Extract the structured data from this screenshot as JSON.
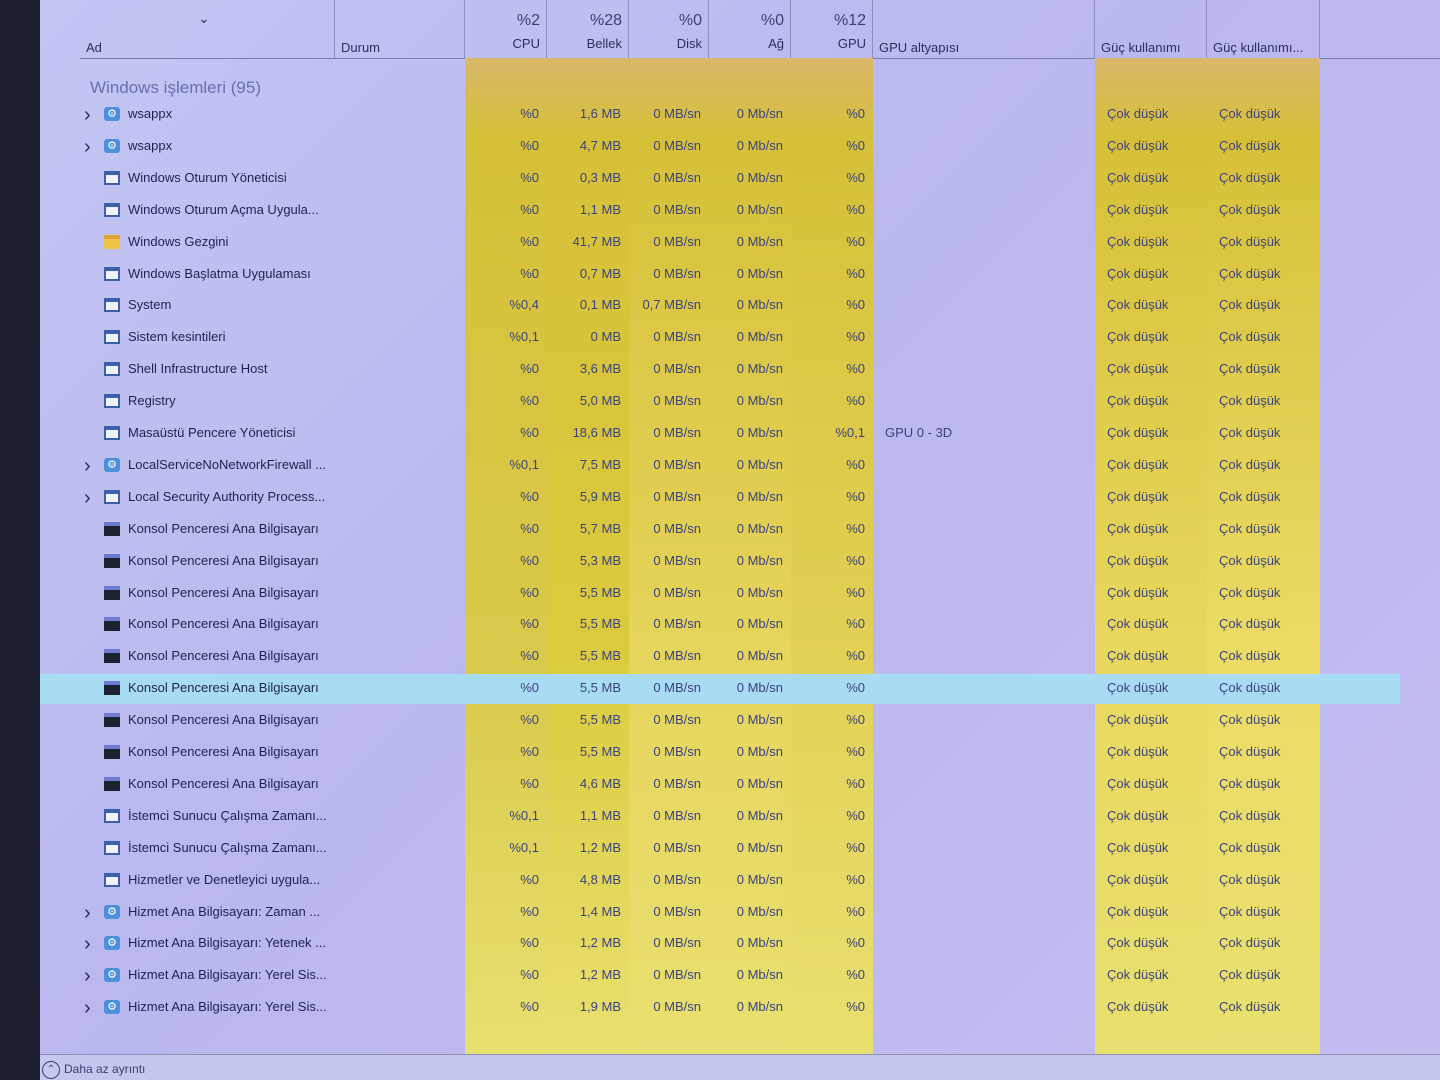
{
  "header": {
    "sort_chevron": "⌄",
    "columns": [
      {
        "key": "name",
        "label": "Ad",
        "percent": ""
      },
      {
        "key": "status",
        "label": "Durum",
        "percent": ""
      },
      {
        "key": "cpu",
        "label": "CPU",
        "percent": "%2"
      },
      {
        "key": "memory",
        "label": "Bellek",
        "percent": "%28"
      },
      {
        "key": "disk",
        "label": "Disk",
        "percent": "%0"
      },
      {
        "key": "network",
        "label": "Ağ",
        "percent": "%0"
      },
      {
        "key": "gpu",
        "label": "GPU",
        "percent": "%12"
      },
      {
        "key": "gpu_engine",
        "label": "GPU altyapısı",
        "percent": ""
      },
      {
        "key": "power",
        "label": "Güç kullanımı",
        "percent": ""
      },
      {
        "key": "power_trend",
        "label": "Güç kullanımı...",
        "percent": ""
      }
    ]
  },
  "group": {
    "title": "Windows işlemleri (95)"
  },
  "processes": [
    {
      "name": "wsappx",
      "icon": "gear",
      "expand": true,
      "cpu": "%0",
      "mem": "1,6 MB",
      "disk": "0 MB/sn",
      "net": "0 Mb/sn",
      "gpu": "%0",
      "engine": "",
      "power": "Çok düşük",
      "trend": "Çok düşük"
    },
    {
      "name": "wsappx",
      "icon": "gear",
      "expand": true,
      "cpu": "%0",
      "mem": "4,7 MB",
      "disk": "0 MB/sn",
      "net": "0 Mb/sn",
      "gpu": "%0",
      "engine": "",
      "power": "Çok düşük",
      "trend": "Çok düşük"
    },
    {
      "name": "Windows Oturum Yöneticisi",
      "icon": "window",
      "expand": false,
      "cpu": "%0",
      "mem": "0,3 MB",
      "disk": "0 MB/sn",
      "net": "0 Mb/sn",
      "gpu": "%0",
      "engine": "",
      "power": "Çok düşük",
      "trend": "Çok düşük"
    },
    {
      "name": "Windows Oturum Açma Uygula...",
      "icon": "window",
      "expand": false,
      "cpu": "%0",
      "mem": "1,1 MB",
      "disk": "0 MB/sn",
      "net": "0 Mb/sn",
      "gpu": "%0",
      "engine": "",
      "power": "Çok düşük",
      "trend": "Çok düşük"
    },
    {
      "name": "Windows Gezgini",
      "icon": "folder",
      "expand": false,
      "cpu": "%0",
      "mem": "41,7 MB",
      "disk": "0 MB/sn",
      "net": "0 Mb/sn",
      "gpu": "%0",
      "engine": "",
      "power": "Çok düşük",
      "trend": "Çok düşük"
    },
    {
      "name": "Windows Başlatma Uygulaması",
      "icon": "window",
      "expand": false,
      "cpu": "%0",
      "mem": "0,7 MB",
      "disk": "0 MB/sn",
      "net": "0 Mb/sn",
      "gpu": "%0",
      "engine": "",
      "power": "Çok düşük",
      "trend": "Çok düşük"
    },
    {
      "name": "System",
      "icon": "window",
      "expand": false,
      "cpu": "%0,4",
      "mem": "0,1 MB",
      "disk": "0,7 MB/sn",
      "net": "0 Mb/sn",
      "gpu": "%0",
      "engine": "",
      "power": "Çok düşük",
      "trend": "Çok düşük"
    },
    {
      "name": "Sistem kesintileri",
      "icon": "window",
      "expand": false,
      "cpu": "%0,1",
      "mem": "0 MB",
      "disk": "0 MB/sn",
      "net": "0 Mb/sn",
      "gpu": "%0",
      "engine": "",
      "power": "Çok düşük",
      "trend": "Çok düşük"
    },
    {
      "name": "Shell Infrastructure Host",
      "icon": "window",
      "expand": false,
      "cpu": "%0",
      "mem": "3,6 MB",
      "disk": "0 MB/sn",
      "net": "0 Mb/sn",
      "gpu": "%0",
      "engine": "",
      "power": "Çok düşük",
      "trend": "Çok düşük"
    },
    {
      "name": "Registry",
      "icon": "window",
      "expand": false,
      "cpu": "%0",
      "mem": "5,0 MB",
      "disk": "0 MB/sn",
      "net": "0 Mb/sn",
      "gpu": "%0",
      "engine": "",
      "power": "Çok düşük",
      "trend": "Çok düşük"
    },
    {
      "name": "Masaüstü Pencere Yöneticisi",
      "icon": "window",
      "expand": false,
      "cpu": "%0",
      "mem": "18,6 MB",
      "disk": "0 MB/sn",
      "net": "0 Mb/sn",
      "gpu": "%0,1",
      "engine": "GPU 0 - 3D",
      "power": "Çok düşük",
      "trend": "Çok düşük"
    },
    {
      "name": "LocalServiceNoNetworkFirewall ...",
      "icon": "gear",
      "expand": true,
      "cpu": "%0,1",
      "mem": "7,5 MB",
      "disk": "0 MB/sn",
      "net": "0 Mb/sn",
      "gpu": "%0",
      "engine": "",
      "power": "Çok düşük",
      "trend": "Çok düşük"
    },
    {
      "name": "Local Security Authority Process...",
      "icon": "window",
      "expand": true,
      "cpu": "%0",
      "mem": "5,9 MB",
      "disk": "0 MB/sn",
      "net": "0 Mb/sn",
      "gpu": "%0",
      "engine": "",
      "power": "Çok düşük",
      "trend": "Çok düşük"
    },
    {
      "name": "Konsol Penceresi Ana Bilgisayarı",
      "icon": "console",
      "expand": false,
      "cpu": "%0",
      "mem": "5,7 MB",
      "disk": "0 MB/sn",
      "net": "0 Mb/sn",
      "gpu": "%0",
      "engine": "",
      "power": "Çok düşük",
      "trend": "Çok düşük"
    },
    {
      "name": "Konsol Penceresi Ana Bilgisayarı",
      "icon": "console",
      "expand": false,
      "cpu": "%0",
      "mem": "5,3 MB",
      "disk": "0 MB/sn",
      "net": "0 Mb/sn",
      "gpu": "%0",
      "engine": "",
      "power": "Çok düşük",
      "trend": "Çok düşük"
    },
    {
      "name": "Konsol Penceresi Ana Bilgisayarı",
      "icon": "console",
      "expand": false,
      "cpu": "%0",
      "mem": "5,5 MB",
      "disk": "0 MB/sn",
      "net": "0 Mb/sn",
      "gpu": "%0",
      "engine": "",
      "power": "Çok düşük",
      "trend": "Çok düşük"
    },
    {
      "name": "Konsol Penceresi Ana Bilgisayarı",
      "icon": "console",
      "expand": false,
      "cpu": "%0",
      "mem": "5,5 MB",
      "disk": "0 MB/sn",
      "net": "0 Mb/sn",
      "gpu": "%0",
      "engine": "",
      "power": "Çok düşük",
      "trend": "Çok düşük"
    },
    {
      "name": "Konsol Penceresi Ana Bilgisayarı",
      "icon": "console",
      "expand": false,
      "cpu": "%0",
      "mem": "5,5 MB",
      "disk": "0 MB/sn",
      "net": "0 Mb/sn",
      "gpu": "%0",
      "engine": "",
      "power": "Çok düşük",
      "trend": "Çok düşük"
    },
    {
      "name": "Konsol Penceresi Ana Bilgisayarı",
      "icon": "console",
      "expand": false,
      "selected": true,
      "cpu": "%0",
      "mem": "5,5 MB",
      "disk": "0 MB/sn",
      "net": "0 Mb/sn",
      "gpu": "%0",
      "engine": "",
      "power": "Çok düşük",
      "trend": "Çok düşük"
    },
    {
      "name": "Konsol Penceresi Ana Bilgisayarı",
      "icon": "console",
      "expand": false,
      "cpu": "%0",
      "mem": "5,5 MB",
      "disk": "0 MB/sn",
      "net": "0 Mb/sn",
      "gpu": "%0",
      "engine": "",
      "power": "Çok düşük",
      "trend": "Çok düşük"
    },
    {
      "name": "Konsol Penceresi Ana Bilgisayarı",
      "icon": "console",
      "expand": false,
      "cpu": "%0",
      "mem": "5,5 MB",
      "disk": "0 MB/sn",
      "net": "0 Mb/sn",
      "gpu": "%0",
      "engine": "",
      "power": "Çok düşük",
      "trend": "Çok düşük"
    },
    {
      "name": "Konsol Penceresi Ana Bilgisayarı",
      "icon": "console",
      "expand": false,
      "cpu": "%0",
      "mem": "4,6 MB",
      "disk": "0 MB/sn",
      "net": "0 Mb/sn",
      "gpu": "%0",
      "engine": "",
      "power": "Çok düşük",
      "trend": "Çok düşük"
    },
    {
      "name": "İstemci Sunucu Çalışma Zamanı...",
      "icon": "window",
      "expand": false,
      "cpu": "%0,1",
      "mem": "1,1 MB",
      "disk": "0 MB/sn",
      "net": "0 Mb/sn",
      "gpu": "%0",
      "engine": "",
      "power": "Çok düşük",
      "trend": "Çok düşük"
    },
    {
      "name": "İstemci Sunucu Çalışma Zamanı...",
      "icon": "window",
      "expand": false,
      "cpu": "%0,1",
      "mem": "1,2 MB",
      "disk": "0 MB/sn",
      "net": "0 Mb/sn",
      "gpu": "%0",
      "engine": "",
      "power": "Çok düşük",
      "trend": "Çok düşük"
    },
    {
      "name": "Hizmetler ve Denetleyici uygula...",
      "icon": "window",
      "expand": false,
      "cpu": "%0",
      "mem": "4,8 MB",
      "disk": "0 MB/sn",
      "net": "0 Mb/sn",
      "gpu": "%0",
      "engine": "",
      "power": "Çok düşük",
      "trend": "Çok düşük"
    },
    {
      "name": "Hizmet Ana Bilgisayarı: Zaman ...",
      "icon": "gear",
      "expand": true,
      "cpu": "%0",
      "mem": "1,4 MB",
      "disk": "0 MB/sn",
      "net": "0 Mb/sn",
      "gpu": "%0",
      "engine": "",
      "power": "Çok düşük",
      "trend": "Çok düşük"
    },
    {
      "name": "Hizmet Ana Bilgisayarı: Yetenek ...",
      "icon": "gear",
      "expand": true,
      "cpu": "%0",
      "mem": "1,2 MB",
      "disk": "0 MB/sn",
      "net": "0 Mb/sn",
      "gpu": "%0",
      "engine": "",
      "power": "Çok düşük",
      "trend": "Çok düşük"
    },
    {
      "name": "Hizmet Ana Bilgisayarı: Yerel Sis...",
      "icon": "gear",
      "expand": true,
      "cpu": "%0",
      "mem": "1,2 MB",
      "disk": "0 MB/sn",
      "net": "0 Mb/sn",
      "gpu": "%0",
      "engine": "",
      "power": "Çok düşük",
      "trend": "Çok düşük"
    },
    {
      "name": "Hizmet Ana Bilgisayarı: Yerel Sis...",
      "icon": "gear",
      "expand": true,
      "cpu": "%0",
      "mem": "1,9 MB",
      "disk": "0 MB/sn",
      "net": "0 Mb/sn",
      "gpu": "%0",
      "engine": "",
      "power": "Çok düşük",
      "trend": "Çok düşük"
    }
  ],
  "colors": {
    "cell_highlight": "#e8cf4a",
    "cell_highlight_alt": "#f2e26a",
    "selected_row": "#a8dcf3"
  },
  "footer": {
    "more_label": "Daha az ayrıntı"
  }
}
